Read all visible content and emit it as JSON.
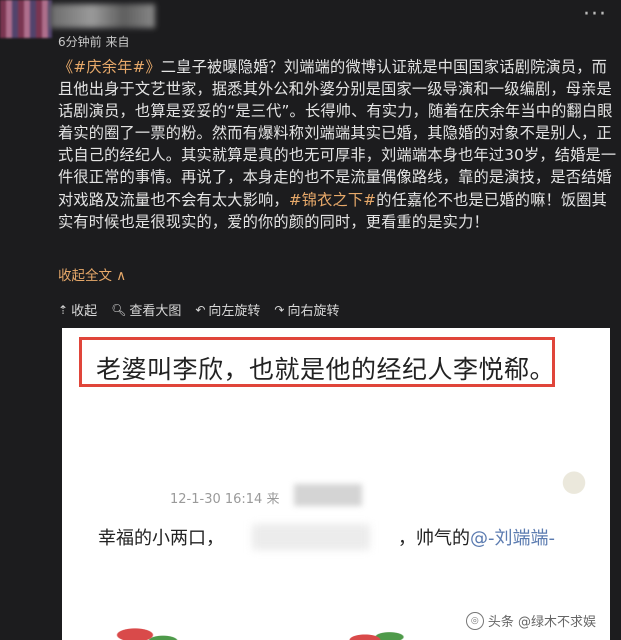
{
  "post": {
    "meta_text": "6分钟前 来自",
    "body_segments": [
      {
        "text": "《#庆余年#》",
        "type": "hashtag"
      },
      {
        "text": "二皇子被曝隐婚？刘端端的微博认证就是中国国家话剧院演员，而且他出身于文艺世家，据悉其外公和外婆分别是国家一级导演和一级编剧，母亲是话剧演员，也算是妥妥的“是三代”。长得帅、有实力，随着在庆余年当中的翻白眼着实的圈了一票的粉。然而有爆料称刘端端其实已婚，其隐婚的对象不是别人，正式自己的经纪人。其实就算是真的也无可厚非，刘端端本身也年过30岁，结婚是一件很正常的事情。再说了，本身走的也不是流量偶像路线，靠的是演技，是否结婚对戏路及流量也不会有太大影响，",
        "type": "text"
      },
      {
        "text": "#锦衣之下#",
        "type": "hashtag"
      },
      {
        "text": "的任嘉伦不也是已婚的嘛！饭圈其实有时候也是很现实的，爱的你的颜的同时，更看重的是实力！",
        "type": "text"
      }
    ],
    "collapse_label": "收起全文 ∧"
  },
  "toolbar": {
    "items": [
      {
        "icon": "collapse-up-icon",
        "glyph": "⇡",
        "label": "收起"
      },
      {
        "icon": "magnify-icon",
        "glyph": "🔍︎",
        "label": "查看大图"
      },
      {
        "icon": "rotate-left-icon",
        "glyph": "↶",
        "label": "向左旋转"
      },
      {
        "icon": "rotate-right-icon",
        "glyph": "↷",
        "label": "向右旋转"
      }
    ]
  },
  "image": {
    "highlight_text": "老婆叫李欣，也就是他的经纪人李悦郗。",
    "timestamp": "12-1-30 16:14  来",
    "couple_prefix": "幸福的小两口，",
    "couple_suffix": "，帅气的",
    "mention": "@-刘端端-",
    "watermark": "头条 @绿木不求娱",
    "highlight_color": "#e0453a"
  },
  "colors": {
    "background": "#1c1c1e",
    "hashtag": "#e7a96a",
    "mention": "#5b7bb0"
  }
}
